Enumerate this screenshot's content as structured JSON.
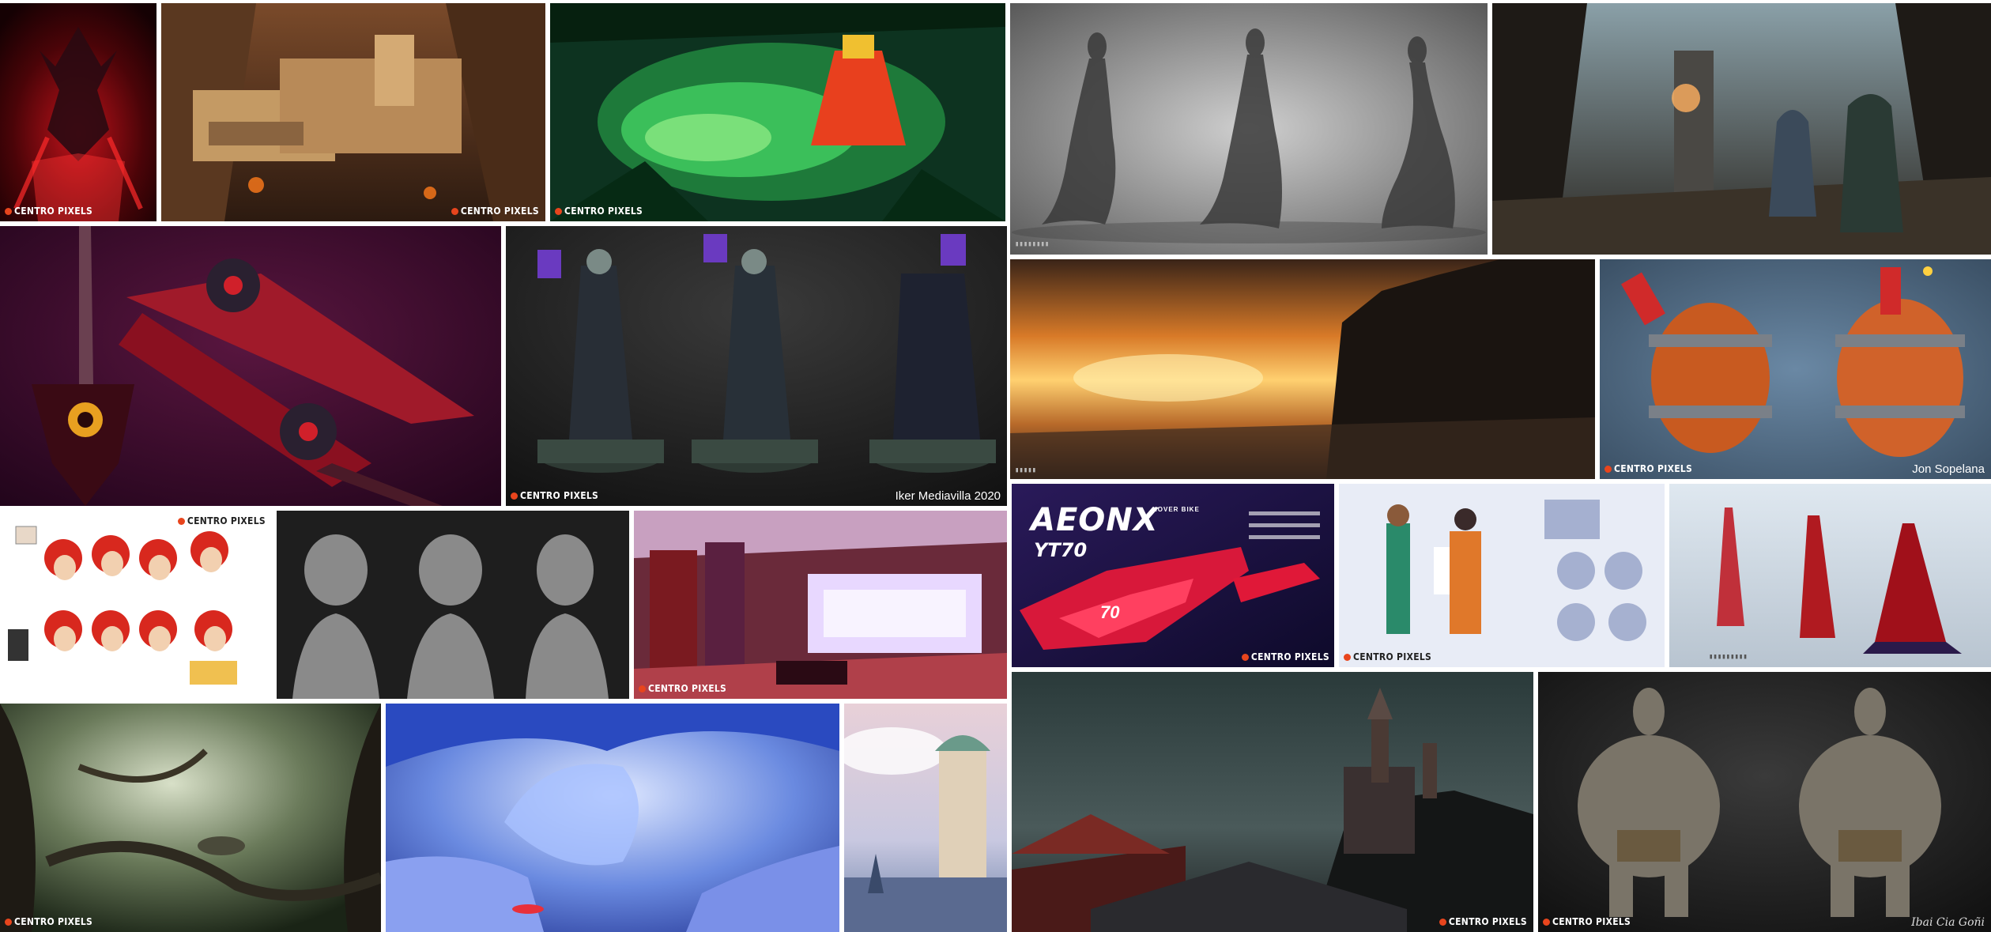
{
  "brand": {
    "logo_text": "CENTRO PIXELS",
    "accent": "#e8451d"
  },
  "credits": {
    "liches": "Iker Mediavilla 2020",
    "barrels": "Jon Sopelana",
    "trolls": "Ibai Cia Goñi"
  },
  "aeonx": {
    "title": "AEONX",
    "model": "YT70",
    "subtitle": "HOVER BIKE",
    "number": "70"
  },
  "tiles": [
    {
      "name": "demon-red-tile"
    },
    {
      "name": "canyon-fortress-tile"
    },
    {
      "name": "jungle-temple-tile"
    },
    {
      "name": "tentacle-creature-sculpt-tile"
    },
    {
      "name": "cathedral-scene-tile"
    },
    {
      "name": "demon-swords-tile"
    },
    {
      "name": "lich-statue-tile"
    },
    {
      "name": "sunset-coast-tile"
    },
    {
      "name": "dynamite-barrel-tile"
    },
    {
      "name": "red-hair-character-sheet-tile"
    },
    {
      "name": "clay-busts-tile"
    },
    {
      "name": "bedroom-render-tile"
    },
    {
      "name": "aeonx-hover-bike-tile"
    },
    {
      "name": "character-design-sheet-tile"
    },
    {
      "name": "red-creatures-tile"
    },
    {
      "name": "misty-forest-tile"
    },
    {
      "name": "ice-cave-tile"
    },
    {
      "name": "lighthouse-tile"
    },
    {
      "name": "castle-cliff-tile"
    },
    {
      "name": "troll-models-tile"
    }
  ]
}
